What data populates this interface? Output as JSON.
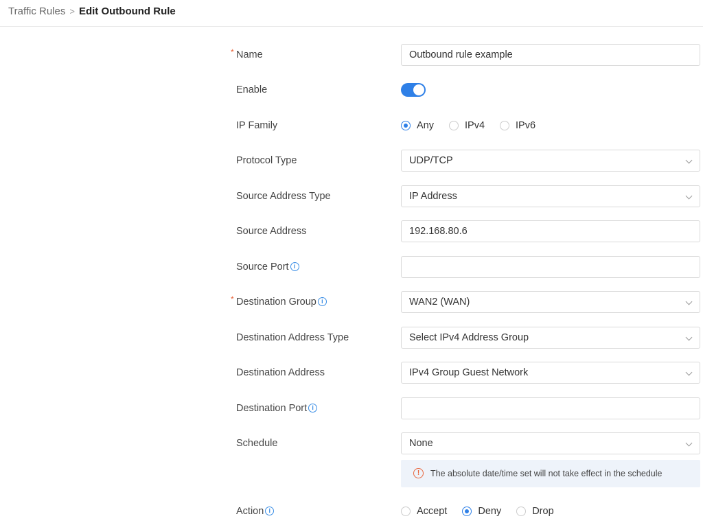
{
  "breadcrumb": {
    "parent": "Traffic Rules",
    "separator": ">",
    "current": "Edit Outbound Rule"
  },
  "form": {
    "name": {
      "label": "Name",
      "required": "*",
      "value": "Outbound rule example"
    },
    "enable": {
      "label": "Enable",
      "checked": true
    },
    "ip_family": {
      "label": "IP Family",
      "options": [
        "Any",
        "IPv4",
        "IPv6"
      ],
      "selected": "Any"
    },
    "protocol_type": {
      "label": "Protocol Type",
      "value": "UDP/TCP"
    },
    "source_address_type": {
      "label": "Source Address Type",
      "value": "IP Address"
    },
    "source_address": {
      "label": "Source Address",
      "value": "192.168.80.6"
    },
    "source_port": {
      "label": "Source Port",
      "value": ""
    },
    "destination_group": {
      "label": "Destination Group",
      "required": "*",
      "value": "WAN2 (WAN)"
    },
    "destination_address_type": {
      "label": "Destination Address Type",
      "value": "Select IPv4 Address Group"
    },
    "destination_address": {
      "label": "Destination Address",
      "value": "IPv4 Group Guest Network"
    },
    "destination_port": {
      "label": "Destination Port",
      "value": ""
    },
    "schedule": {
      "label": "Schedule",
      "value": "None"
    },
    "schedule_notice": "The absolute date/time set will not take effect in the schedule",
    "action": {
      "label": "Action",
      "options": [
        "Accept",
        "Deny",
        "Drop"
      ],
      "selected": "Deny"
    }
  },
  "icons": {
    "info": "i",
    "warning": "!"
  },
  "colors": {
    "accent": "#2f80e7",
    "required": "#e8663d",
    "notice_bg": "#eef3fa"
  }
}
